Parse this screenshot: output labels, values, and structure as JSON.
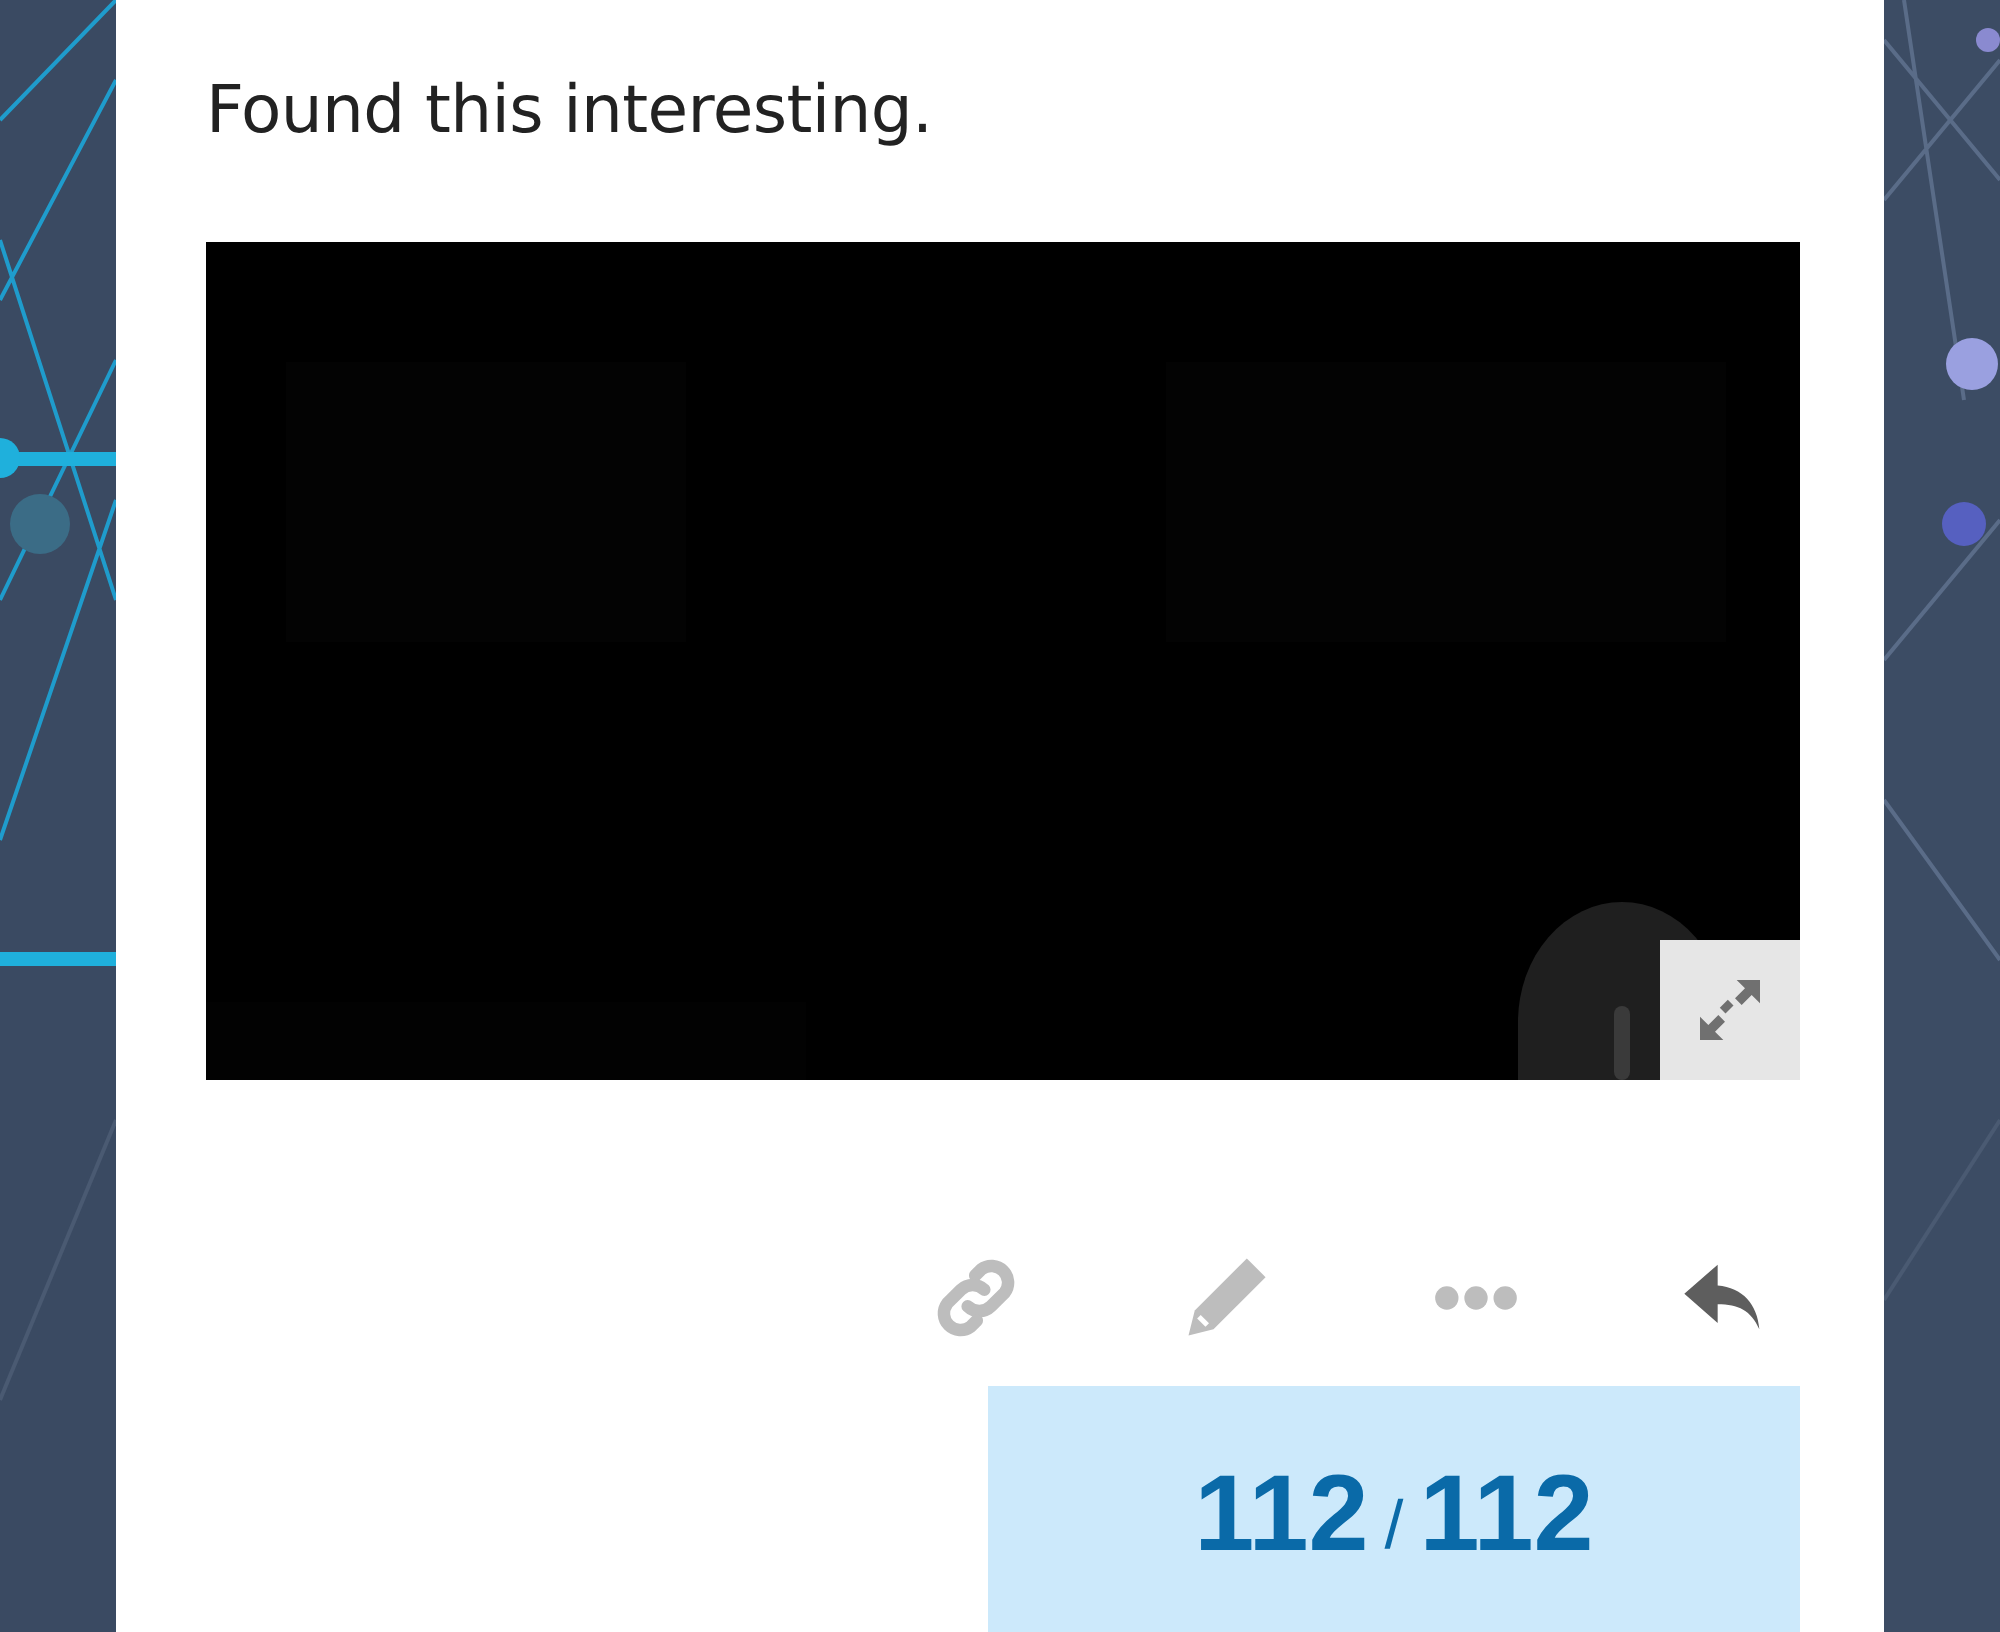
{
  "post": {
    "text": "Found this interesting."
  },
  "counter": {
    "current": "112",
    "separator": "/",
    "total": "112"
  }
}
